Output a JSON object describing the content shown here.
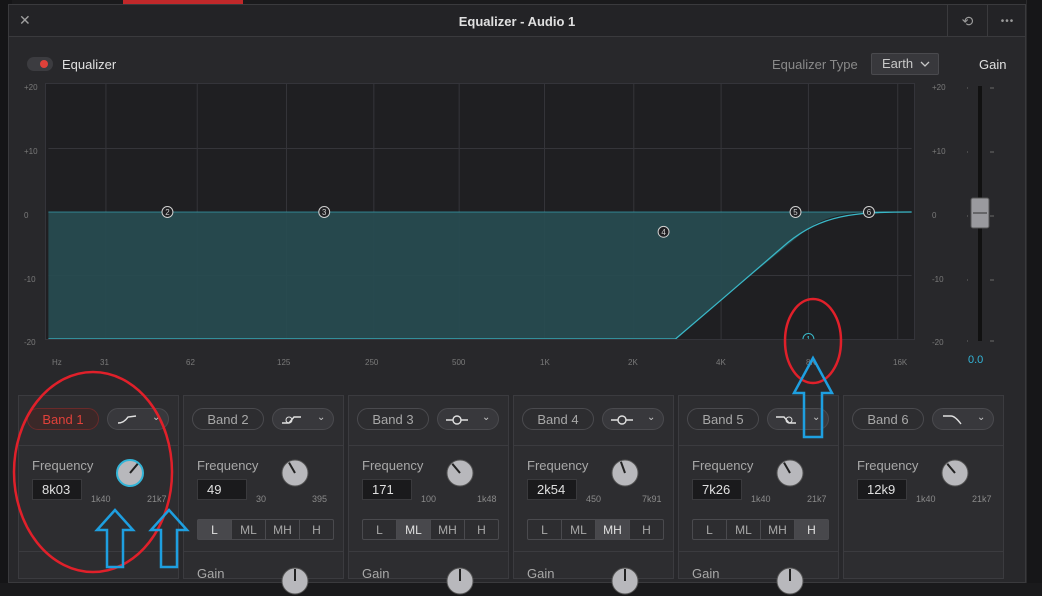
{
  "window": {
    "title": "Equalizer - Audio 1"
  },
  "toolbar": {
    "close": "✕",
    "reset": "⟲",
    "more": "•••"
  },
  "eq": {
    "label": "Equalizer",
    "type_label": "Equalizer Type",
    "type_value": "Earth",
    "gain_title": "Gain",
    "gain_value": "0.0"
  },
  "graph": {
    "y_left": [
      "+20",
      "+10",
      "0",
      "-10",
      "-20"
    ],
    "y_right": [
      "+20",
      "+10",
      "0",
      "-10",
      "-20"
    ],
    "x_labels": [
      "Hz",
      "31",
      "62",
      "125",
      "250",
      "500",
      "1K",
      "2K",
      "4K",
      "8K",
      "16K"
    ],
    "nodes": [
      "1",
      "2",
      "3",
      "4",
      "5",
      "6"
    ]
  },
  "bands": [
    {
      "label": "Band 1",
      "active": true,
      "freq": "8k03",
      "min": "1k40",
      "max": "21k7",
      "lmh": [],
      "has_gain": false
    },
    {
      "label": "Band 2",
      "active": false,
      "freq": "49",
      "min": "30",
      "max": "395",
      "lmh": [
        "L",
        "ML",
        "MH",
        "H"
      ],
      "lmh_sel": 0,
      "has_gain": true
    },
    {
      "label": "Band 3",
      "active": false,
      "freq": "171",
      "min": "100",
      "max": "1k48",
      "lmh": [
        "L",
        "ML",
        "MH",
        "H"
      ],
      "lmh_sel": 1,
      "has_gain": true
    },
    {
      "label": "Band 4",
      "active": false,
      "freq": "2k54",
      "min": "450",
      "max": "7k91",
      "lmh": [
        "L",
        "ML",
        "MH",
        "H"
      ],
      "lmh_sel": 2,
      "has_gain": true
    },
    {
      "label": "Band 5",
      "active": false,
      "freq": "7k26",
      "min": "1k40",
      "max": "21k7",
      "lmh": [
        "L",
        "ML",
        "MH",
        "H"
      ],
      "lmh_sel": 3,
      "has_gain": true
    },
    {
      "label": "Band 6",
      "active": false,
      "freq": "12k9",
      "min": "1k40",
      "max": "21k7",
      "lmh": [],
      "has_gain": false
    }
  ],
  "labels": {
    "frequency": "Frequency",
    "gain": "Gain"
  },
  "colors": {
    "accent": "#33b5d8",
    "active_red": "#e0413a",
    "annotation_red": "#e0202a",
    "annotation_blue": "#1e9fe0"
  }
}
